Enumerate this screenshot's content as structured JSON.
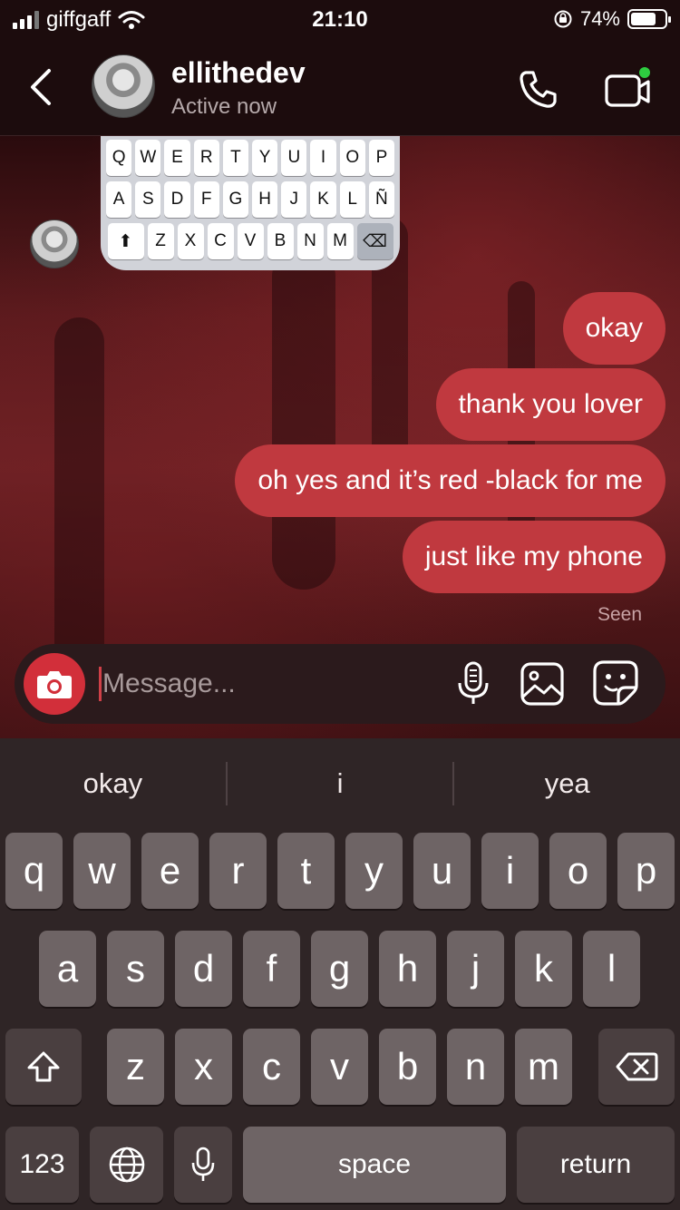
{
  "status_bar": {
    "carrier": "giffgaff",
    "time": "21:10",
    "battery": "74%",
    "battery_level": 0.74
  },
  "header": {
    "username": "ellithedev",
    "status": "Active now"
  },
  "shared_keyboard": {
    "row1": [
      "Q",
      "W",
      "E",
      "R",
      "T",
      "Y",
      "U",
      "I",
      "O",
      "P"
    ],
    "row2": [
      "A",
      "S",
      "D",
      "F",
      "G",
      "H",
      "J",
      "K",
      "L",
      "Ñ"
    ],
    "row3": [
      "Z",
      "X",
      "C",
      "V",
      "B",
      "N",
      "M"
    ]
  },
  "messages": [
    {
      "text": "okay"
    },
    {
      "text": "thank you lover"
    },
    {
      "text": "oh yes and it’s red -black for me"
    },
    {
      "text": "just like my phone"
    }
  ],
  "seen_label": "Seen",
  "composer": {
    "placeholder": "Message..."
  },
  "keyboard": {
    "suggestions": [
      "okay",
      "i",
      "yea"
    ],
    "row1": [
      "q",
      "w",
      "e",
      "r",
      "t",
      "y",
      "u",
      "i",
      "o",
      "p"
    ],
    "row2": [
      "a",
      "s",
      "d",
      "f",
      "g",
      "h",
      "j",
      "k",
      "l"
    ],
    "row3": [
      "z",
      "x",
      "c",
      "v",
      "b",
      "n",
      "m"
    ],
    "numbers_label": "123",
    "space_label": "space",
    "return_label": "return"
  },
  "colors": {
    "bubble": "#c0393f",
    "camera": "#d22f3a",
    "online": "#2ecc40"
  },
  "icons": [
    "back-icon",
    "phone-icon",
    "video-icon",
    "camera-icon",
    "microphone-icon",
    "gallery-icon",
    "sticker-icon",
    "shift-icon",
    "delete-icon",
    "globe-icon"
  ]
}
